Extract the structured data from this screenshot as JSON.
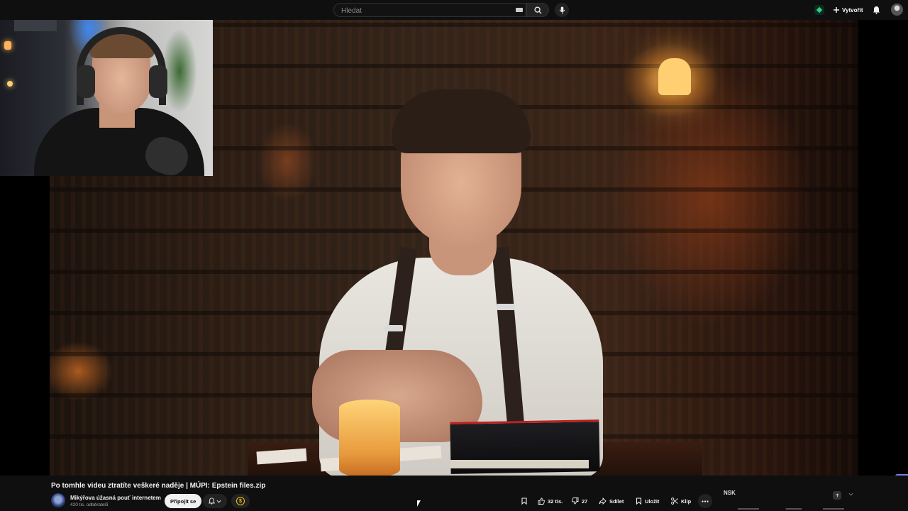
{
  "search": {
    "placeholder": "Hledat"
  },
  "header": {
    "create_label": "Vytvořit"
  },
  "video": {
    "title": "Po tomhle videu ztratíte veškeré naděje | MÚPI: Epstein files.zip"
  },
  "channel": {
    "name": "Mikýřova úžasná pouť internetem",
    "subscribers": "420 tis. odběratelů",
    "join_label": "Připojit se",
    "thanks_symbol": "$"
  },
  "actions": {
    "likes": "32 tis.",
    "dislikes": "27",
    "share_label": "Sdílet",
    "save_label": "Uložit",
    "clip_label": "Klip"
  },
  "side_panel": {
    "logo_text": "NSK"
  },
  "colors": {
    "background": "#0f0f0f",
    "surface": "#222222",
    "text": "#f1f1f1",
    "secondary_text": "#aaaaaa",
    "join_button": "#f1f1f1"
  },
  "icons": [
    "keyboard-icon",
    "search-icon",
    "mic-icon",
    "extension-icon",
    "plus-icon",
    "bell-icon",
    "avatar",
    "bell-icon",
    "chevron-down-icon",
    "dollar-icon",
    "bookmark-icon",
    "thumbs-up-icon",
    "thumbs-down-icon",
    "share-icon",
    "save-icon",
    "scissors-icon",
    "more-icon"
  ]
}
